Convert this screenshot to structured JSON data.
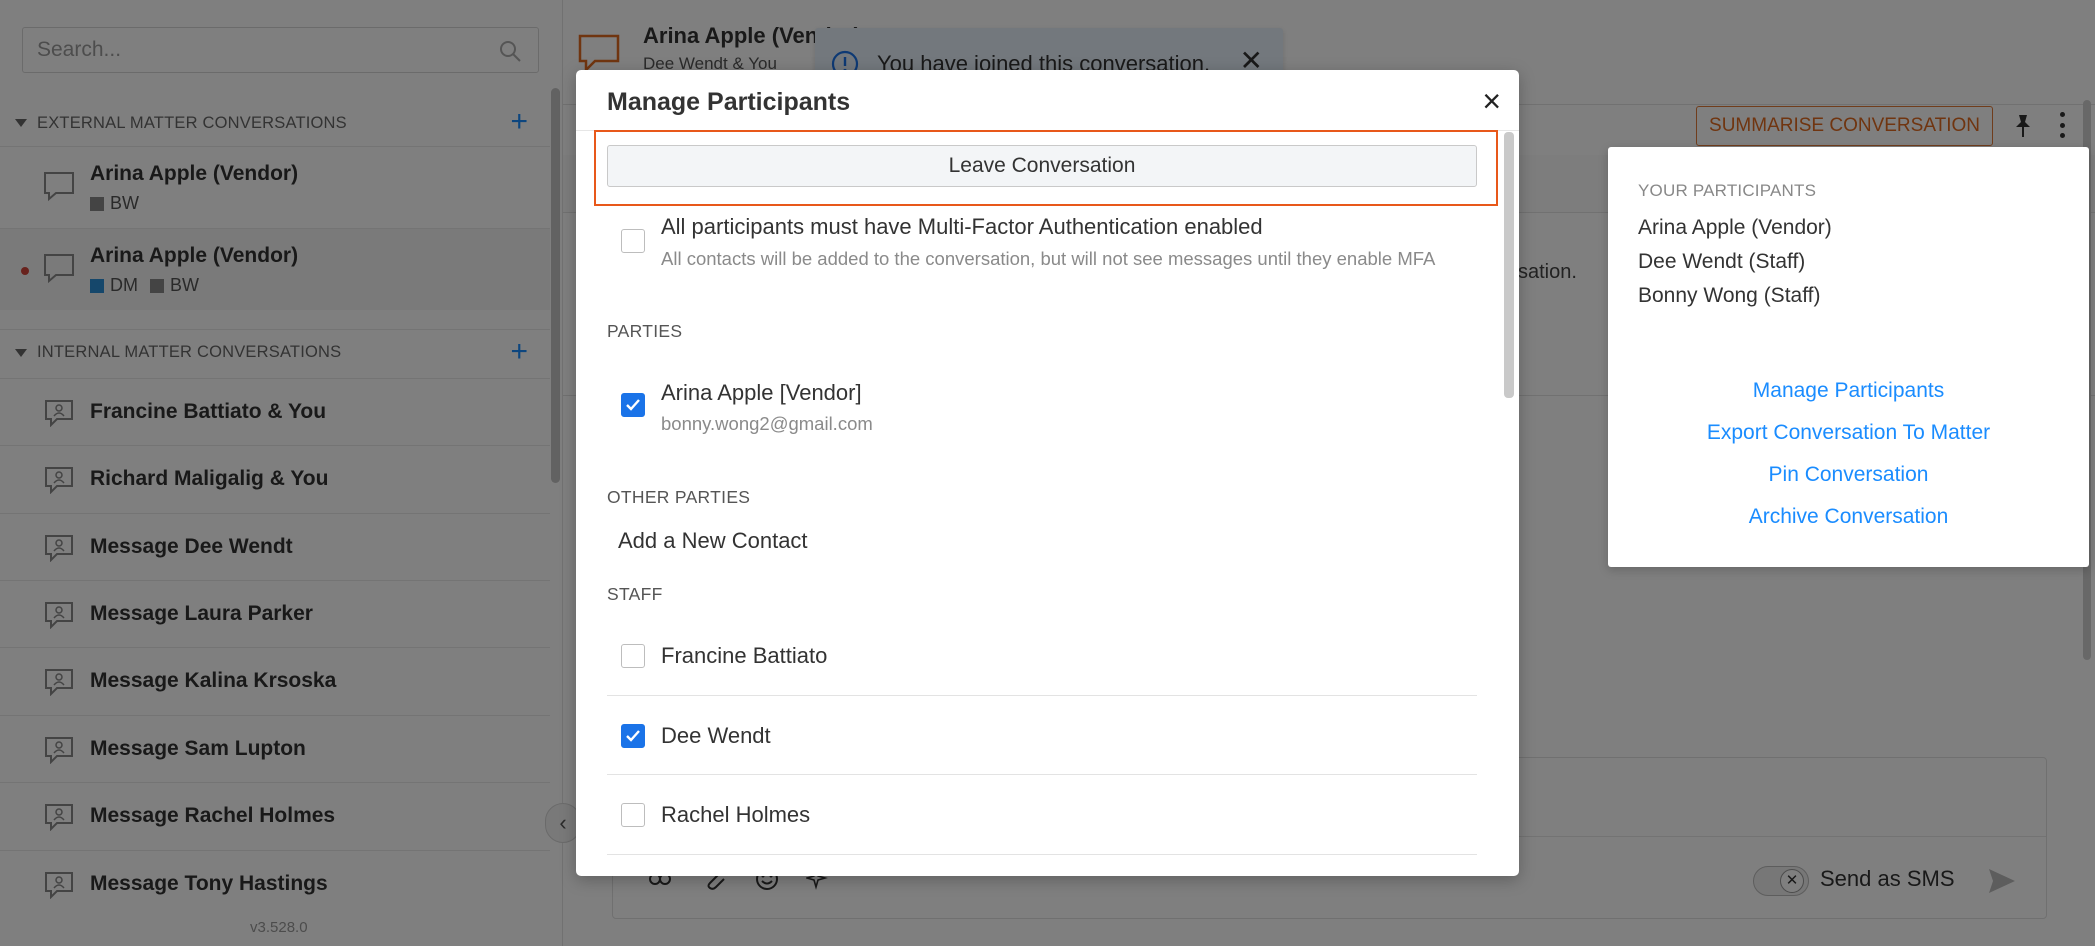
{
  "sidebar": {
    "search_placeholder": "Search...",
    "external_header": "EXTERNAL MATTER CONVERSATIONS",
    "internal_header": "INTERNAL MATTER CONVERSATIONS",
    "external_conversations": [
      {
        "name": "Arina Apple (Vendor)",
        "tags": [
          {
            "label": "BW",
            "color": "#888888"
          }
        ]
      },
      {
        "name": "Arina Apple (Vendor)",
        "tags": [
          {
            "label": "DM",
            "color": "#2a8fd6"
          },
          {
            "label": "BW",
            "color": "#888888"
          }
        ]
      }
    ],
    "internal_conversations": [
      "Francine Battiato & You",
      "Richard Maligalig & You",
      "Message Dee Wendt",
      "Message Laura Parker",
      "Message Kalina Krsoska",
      "Message Sam Lupton",
      "Message Rachel Holmes",
      "Message Tony Hastings"
    ],
    "version": "v3.528.0"
  },
  "header": {
    "title": "Arina Apple (Vendor)",
    "subtitle": "Dee Wendt & You",
    "summarise_label": "SUMMARISE CONVERSATION"
  },
  "toast": {
    "message": "You have joined this conversation."
  },
  "chat": {
    "message_fragment": "sation."
  },
  "composer": {
    "sms_label": "Send as SMS"
  },
  "dropdown": {
    "title": "YOUR PARTICIPANTS",
    "participants": [
      "Arina Apple (Vendor)",
      "Dee Wendt (Staff)",
      "Bonny Wong (Staff)"
    ],
    "actions": [
      "Manage Participants",
      "Export Conversation To Matter",
      "Pin Conversation",
      "Archive Conversation"
    ]
  },
  "modal": {
    "title": "Manage Participants",
    "close": "×",
    "leave_label": "Leave Conversation",
    "mfa_title": "All participants must have Multi-Factor Authentication enabled",
    "mfa_desc": "All contacts will be added to the conversation, but will not see messages until they enable MFA",
    "mfa_checked": false,
    "parties_label": "PARTIES",
    "party": {
      "name": "Arina Apple [Vendor]",
      "email": "bonny.wong2@gmail.com",
      "checked": true
    },
    "other_parties_label": "OTHER PARTIES",
    "add_contact_label": "Add a New Contact",
    "staff_label": "STAFF",
    "staff": [
      {
        "name": "Francine Battiato",
        "checked": false
      },
      {
        "name": "Dee Wendt",
        "checked": true
      },
      {
        "name": "Rachel Holmes",
        "checked": false
      }
    ]
  },
  "colors": {
    "accent": "#1a8cff",
    "highlight": "#e8581a",
    "checkbox": "#1a73e8"
  }
}
